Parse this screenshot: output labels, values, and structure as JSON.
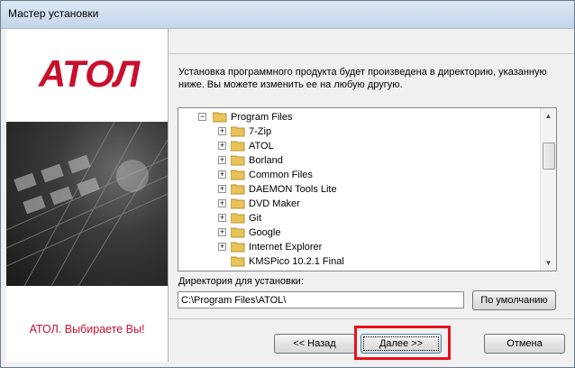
{
  "window": {
    "title": "Мастер установки"
  },
  "sidebar": {
    "logo_text": "АТОЛ",
    "slogan": "АТОЛ. Выбираете Вы!"
  },
  "description": "Установка программного продукта будет произведена в директорию, указанную ниже. Вы можете изменить ее на любую другую.",
  "tree": {
    "root": "Program Files",
    "items": [
      "7-Zip",
      "ATOL",
      "Borland",
      "Common Files",
      "DAEMON Tools Lite",
      "DVD Maker",
      "Git",
      "Google",
      "Internet Explorer",
      "KMSPico 10.2.1 Final"
    ]
  },
  "directory": {
    "label": "Директория для установки:",
    "value": "C:\\Program Files\\ATOL\\",
    "default_button": "По умолчанию"
  },
  "buttons": {
    "back": "<< Назад",
    "next": "Далее >>",
    "cancel": "Отмена"
  },
  "colors": {
    "brand_red": "#c8102e",
    "highlight": "#e4121c"
  }
}
